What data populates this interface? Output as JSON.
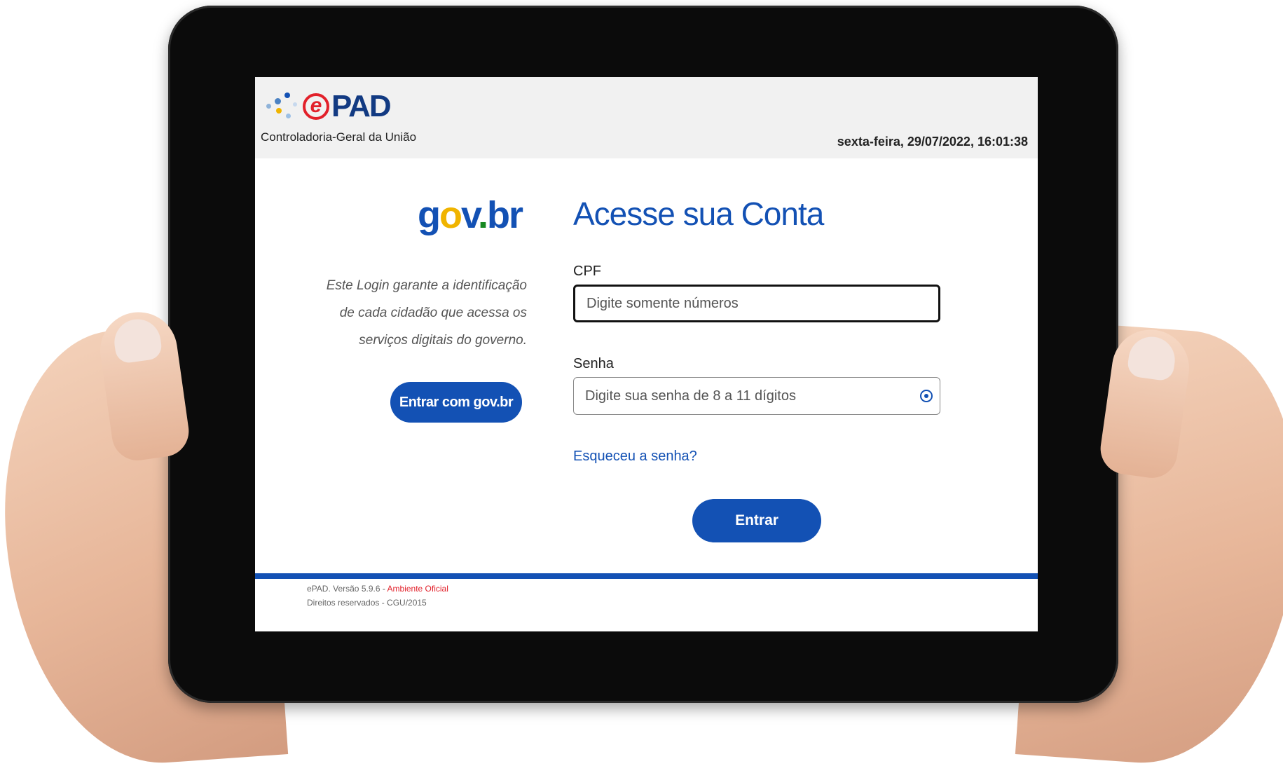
{
  "header": {
    "logo_text": "PAD",
    "org": "Controladoria-Geral da União",
    "datetime": "sexta-feira, 29/07/2022, 16:01:38"
  },
  "left": {
    "govbr_logo": "gov.br",
    "tagline": "Este Login garante a identificação de cada cidadão que acessa os serviços digitais do governo.",
    "govbr_button": "Entrar com gov.br"
  },
  "login": {
    "title": "Acesse sua Conta",
    "cpf_label": "CPF",
    "cpf_placeholder": "Digite somente números",
    "senha_label": "Senha",
    "senha_placeholder": "Digite sua senha de 8 a 11 dígitos",
    "forgot": "Esqueceu a senha?",
    "submit": "Entrar"
  },
  "footer": {
    "version": "ePAD. Versão 5.9.6 - ",
    "environment": "Ambiente Oficial",
    "rights": "Direitos reservados - CGU/2015"
  },
  "colors": {
    "primary": "#1351b4",
    "accent_red": "#e2202a",
    "gov_yellow": "#f0b400",
    "gov_green": "#168821"
  }
}
